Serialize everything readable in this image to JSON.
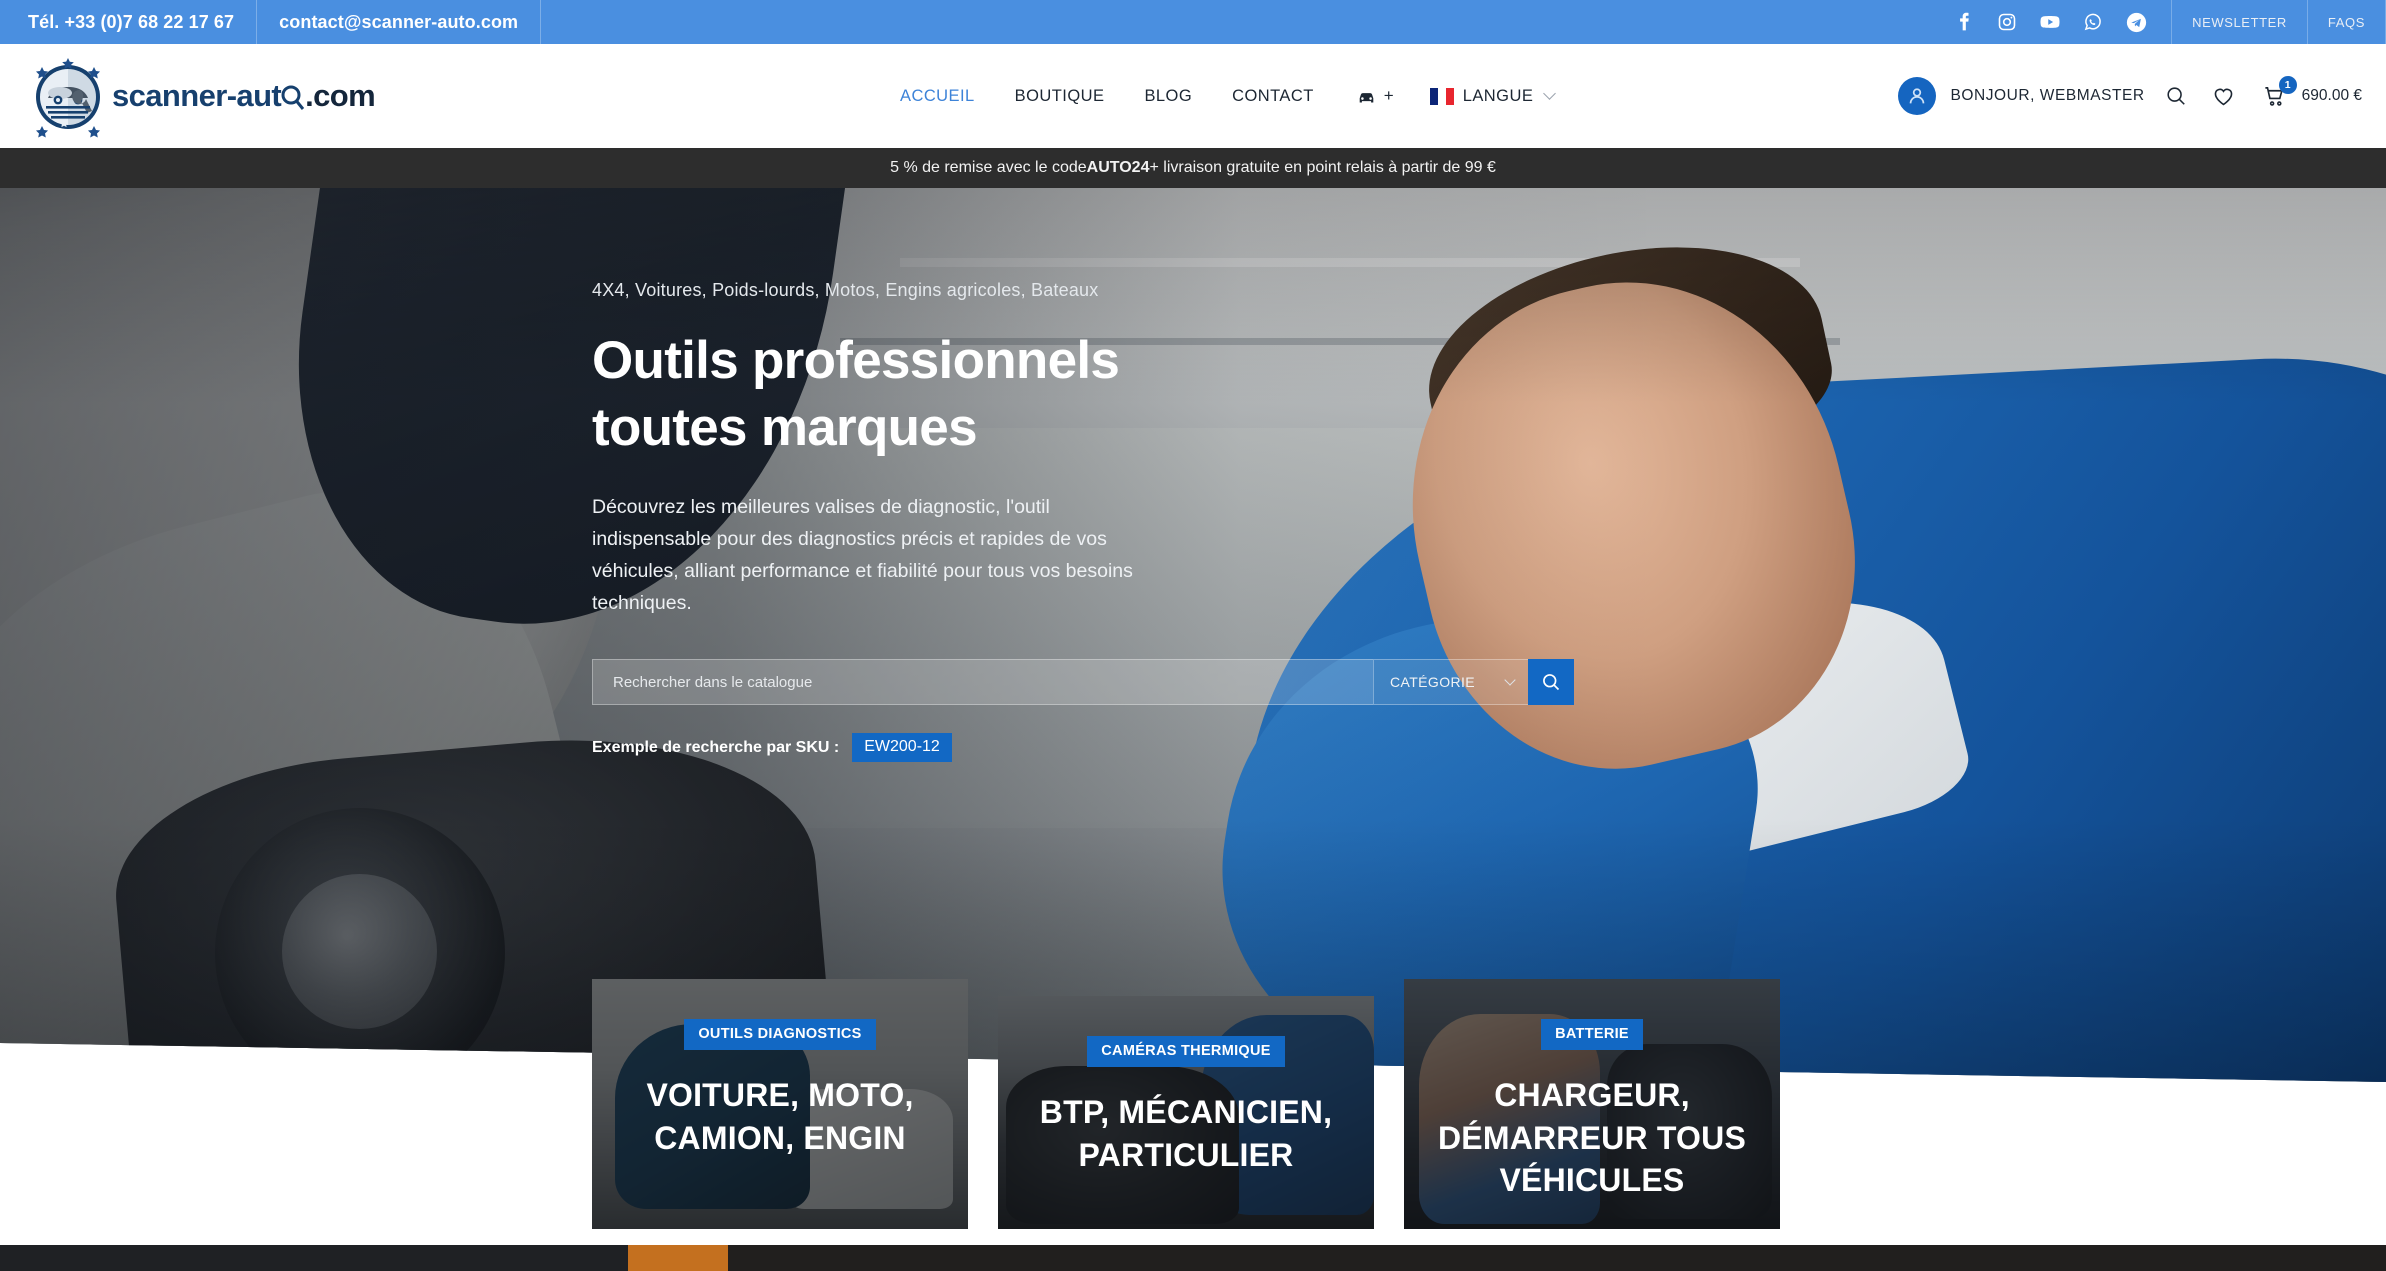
{
  "topbar": {
    "phone": "Tél. +33 (0)7 68 22 17 67",
    "email": "contact@scanner-auto.com",
    "social": [
      {
        "name": "facebook-icon",
        "label": "Facebook"
      },
      {
        "name": "instagram-icon",
        "label": "Instagram"
      },
      {
        "name": "youtube-icon",
        "label": "YouTube"
      },
      {
        "name": "whatsapp-icon",
        "label": "WhatsApp"
      },
      {
        "name": "telegram-icon",
        "label": "Telegram"
      }
    ],
    "newsletter": "NEWSLETTER",
    "faqs": "FAQS",
    "bg_color": "#4a8fe0"
  },
  "header": {
    "logo_text_main": "scanner-aut",
    "logo_text_tail": ".com",
    "nav": [
      {
        "label": "ACCUEIL",
        "active": true
      },
      {
        "label": "BOUTIQUE",
        "active": false
      },
      {
        "label": "BLOG",
        "active": false
      },
      {
        "label": "CONTACT",
        "active": false
      }
    ],
    "vehicle_plus": "+",
    "language_label": "LANGUE",
    "greeting": "BONJOUR, WEBMASTER",
    "cart_count": "1",
    "cart_total": "690.00 €",
    "accent_color": "#1565c0"
  },
  "promo": {
    "prefix": "5 % de remise avec le code ",
    "code": "AUTO24",
    "suffix": " + livraison gratuite en point relais à partir de 99 €",
    "bg_color": "#2d2d2d"
  },
  "hero": {
    "kicker": "4X4, Voitures, Poids-lourds, Motos, Engins agricoles, Bateaux",
    "title_line1": "Outils professionnels",
    "title_line2": "toutes marques",
    "subtitle": "Découvrez les meilleures valises de diagnostic, l'outil indispensable pour des diagnostics précis et rapides de vos véhicules, alliant performance et fiabilité pour tous vos besoins techniques.",
    "search_placeholder": "Rechercher dans le catalogue",
    "search_value": "",
    "category_label": "CATÉGORIE",
    "sku_label": "Exemple de recherche par SKU :",
    "sku_value": "EW200-12",
    "button_color": "#1268c4"
  },
  "cards": [
    {
      "badge": "OUTILS DIAGNOSTICS",
      "title": "VOITURE, MOTO, CAMION, ENGIN"
    },
    {
      "badge": "CAMÉRAS THERMIQUE",
      "title": "BTP, MÉCANICIEN, PARTICULIER"
    },
    {
      "badge": "BATTERIE",
      "title": "CHARGEUR, DÉMARREUR TOUS VÉHICULES"
    }
  ]
}
